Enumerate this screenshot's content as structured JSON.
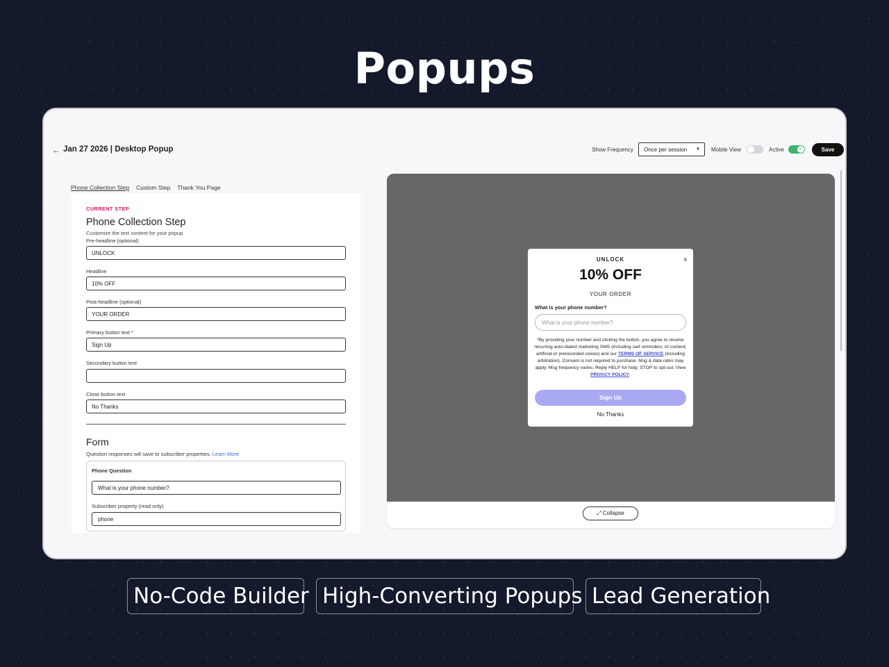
{
  "hero": {
    "title": "Popups"
  },
  "header": {
    "back_icon": "arrow-left-icon",
    "title": "Jan 27 2026 | Desktop Popup",
    "show_frequency_label": "Show Frequency",
    "show_frequency_value": "Once per session",
    "mobile_view_label": "Mobile View",
    "mobile_view_on": false,
    "active_label": "Active",
    "active_on": true,
    "save_label": "Save"
  },
  "tabs": [
    {
      "label": "Phone Collection Step",
      "active": true
    },
    {
      "label": "Custom Step",
      "active": false
    },
    {
      "label": "Thank You Page",
      "active": false
    }
  ],
  "editor": {
    "current_step_label": "CURRENT STEP",
    "step_title": "Phone Collection Step",
    "step_subtitle": "Customize the text content for your popup.",
    "fields": [
      {
        "label": "Pre-headline (optional)",
        "value": "UNLOCK"
      },
      {
        "label": "Headline",
        "value": "10% OFF"
      },
      {
        "label": "Post-headline (optional)",
        "value": "YOUR ORDER"
      },
      {
        "label": "Primary button text *",
        "value": "Sign Up"
      },
      {
        "label": "Secondary button text",
        "value": ""
      },
      {
        "label": "Close button text",
        "value": "No Thanks"
      }
    ],
    "form_title": "Form",
    "form_subtitle": "Question responses will save to subscriber properties.",
    "learn_more": "Learn More",
    "question": {
      "title": "Phone Question",
      "value": "What is your phone number?",
      "property_label": "Subscriber property (read only)",
      "property_value": "phone"
    }
  },
  "preview": {
    "close": "x",
    "pre_headline": "UNLOCK",
    "headline": "10% OFF",
    "post_headline": "YOUR ORDER",
    "question": "What is your phone number?",
    "phone_placeholder": "What is your phone number?",
    "legal_part1": "*By providing your number and clicking the button, you agree to receive recurring auto-dialed marketing SMS (including cart reminders; AI content; artificial or prerecorded voices) and our ",
    "terms_link": "TERMS OF SERVICE",
    "legal_part2": " (including arbitration). Consent is not required to purchase. Msg & data rates may apply. Msg frequency varies. Reply HELP for help; STOP to opt-out. View ",
    "privacy_link": "PRIVACY POLICY",
    "legal_part3": ".",
    "signup_label": "Sign Up",
    "nothanks_label": "No Thanks",
    "collapse_label": "Collapse"
  },
  "pills": [
    "No-Code Builder",
    "High-Converting Popups",
    "Lead Generation"
  ]
}
